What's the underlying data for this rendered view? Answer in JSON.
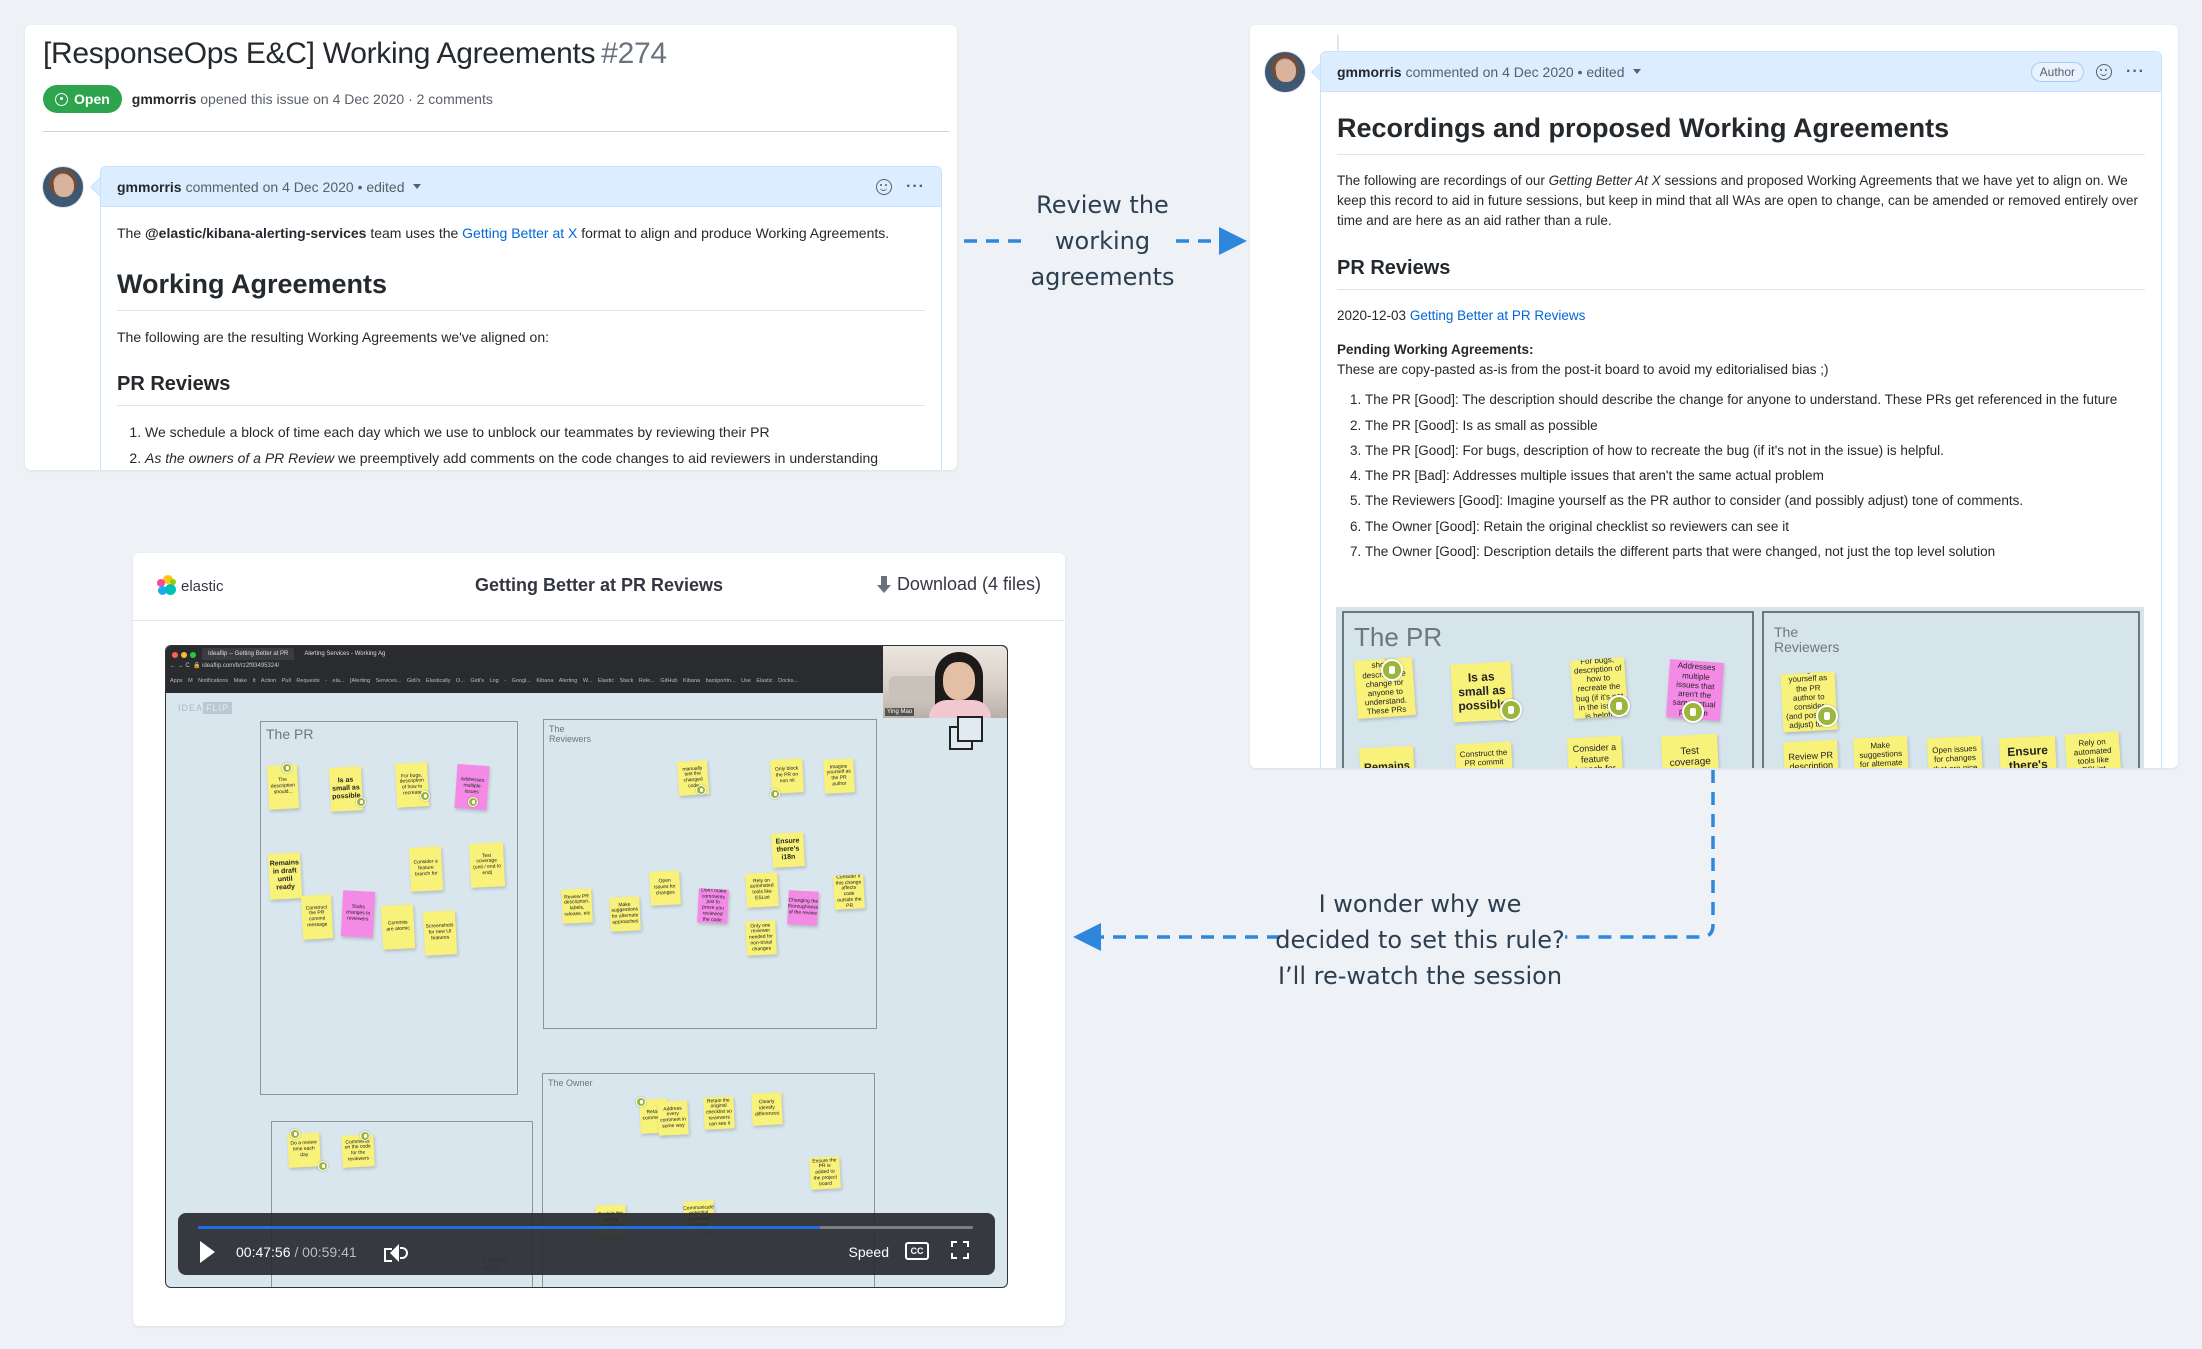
{
  "issue": {
    "title": "[ResponseOps E&C] Working Agreements",
    "number": "#274",
    "state": "Open",
    "author": "gmmorris",
    "meta": "opened this issue on 4 Dec 2020 · 2 comments",
    "comment": {
      "author": "gmmorris",
      "meta": "commented on 4 Dec 2020 • edited",
      "intro_prefix": "The",
      "team": "@elastic/kibana-alerting-services",
      "intro_mid": "team uses the",
      "link": "Getting Better at X",
      "intro_suffix": "format to align and produce Working Agreements.",
      "h1": "Working Agreements",
      "para": "The following are the resulting Working Agreements we've aligned on:",
      "h2": "PR Reviews",
      "items": [
        {
          "em": "",
          "text": "We schedule a block of time each day which we use to unblock our teammates by reviewing their PR"
        },
        {
          "em": "As the owners of a PR Review",
          "text": " we preemptively add comments on the code changes to aid reviewers in understanding"
        }
      ]
    }
  },
  "right_comment": {
    "author": "gmmorris",
    "meta": "commented on 4 Dec 2020 • edited",
    "badge": "Author",
    "h1": "Recordings and proposed Working Agreements",
    "intro_prefix": "The following are recordings of our",
    "intro_em": "Getting Better At X",
    "intro_suffix": "sessions and proposed Working Agreements that we have yet to align on. We keep this record to aid in future sessions, but keep in mind that all WAs are open to change, can be amended or removed entirely over time and are here as an aid rather than a rule.",
    "h2": "PR Reviews",
    "date": "2020-12-03",
    "session_link": "Getting Better at PR Reviews",
    "pending_label": "Pending Working Agreements:",
    "pending_note": "These are copy-pasted as-is from the post-it board to avoid my editorialised bias ;)",
    "items": [
      "The PR [Good]: The description should describe the change for anyone to understand. These PRs get referenced in the future",
      "The PR [Good]: Is as small as possible",
      "The PR [Good]: For bugs, description of how to recreate the bug (if it's not in the issue) is helpful.",
      "The PR [Bad]: Addresses multiple issues that aren't the same actual problem",
      "The Reviewers [Good]: Imagine yourself as the PR author to consider (and possibly adjust) tone of comments.",
      "The Owner [Good]: Retain the original checklist so reviewers can see it",
      "The Owner [Good]: Description details the different parts that were changed, not just the top level solution"
    ],
    "board": {
      "groups": [
        "The PR",
        "The\nReviewers"
      ],
      "stickies": [
        "The description should describe the change for anyone to understand. These PRs get referenced in the future",
        "Is as small as possible",
        "For bugs, description of how to recreate the bug (if it's not in the issue) is helpful",
        "Addresses multiple issues that aren't the same actual problem",
        "Remains",
        "Construct the PR commit message",
        "Consider a feature branch for",
        "Test coverage",
        "Imagine yourself as the PR author to consider (and possibly adjust) tone of comments",
        "Review PR description",
        "Make suggestions for alternate approaches",
        "Open issues for changes that are nice",
        "Ensure there's",
        "Rely on automated tools like ESLint"
      ]
    }
  },
  "video": {
    "brand": "elastic",
    "title": "Getting Better at PR Reviews",
    "download_label": "Download (4 files)",
    "browser": {
      "tabs": [
        "Ideaflip -- Getting Better at PR",
        "Alerting Services - Working Ag"
      ],
      "url": "ideaflip.com/b/rz2f93495324/",
      "bookmarks": "Apps  M  Notifications  Make It Action  Pull Requests - ela...  [Alerting Services...  Gidi's Elastically O...  Gidi's Log - Googl...  Kibana Alerting W...  Elastic Stack Rele...  GitHub  Kibana backportin...  Use Elastic Docks..."
    },
    "board_logo_a": "IDEA",
    "board_logo_b": "FLIP",
    "webcam_name": "Ying Mao",
    "groups": [
      "The PR",
      "The\nReviewers",
      "The Owner",
      ""
    ],
    "group_placeholder": "GROUP\nTITLE",
    "stickies": {
      "pr": [
        "The description should...",
        "Is as small as possible",
        "For bugs, description of how to recreate",
        "Addresses multiple issues",
        "Remains in draft until ready",
        "Consider a feature branch for",
        "Test coverage (unit / end to end)",
        "Construct the PR commit message",
        "Stubs changes to reviewers",
        "Commits are atomic",
        "Screenshots for new UI features"
      ],
      "reviewers": [
        "manually test the changed code",
        "Only block the PR on non nit",
        "Imagine yourself as the PR author",
        "Ensure there's i18n",
        "Review PR description, labels, release, etc",
        "Make suggestions for alternate approaches",
        "Open issues for changes",
        "Don't make comments just to prove you reviewed the code",
        "Rely on automated tools like ESLint",
        "Changing the thoroughness of the review",
        "Only one reviewer needed for non-trivial changes",
        "Consider if this change affects code outside the PR"
      ],
      "owner": [
        "Retain comments",
        "Address every comment in some way",
        "Retain the original checklist so reviewers can see it",
        "Clearly identify differences",
        "Ensure the PR is added to the project board",
        "Communicate potential conflicting changes",
        "Explain the testing approach"
      ],
      "other": [
        "Do a review time each day",
        "Comments on the code for the reviewers"
      ]
    },
    "progress": 0.803,
    "current_time": "00:47:56",
    "duration": "00:59:41",
    "speed_label": "Speed",
    "cc_label": "CC"
  },
  "annotations": {
    "top": "Review the working agreements",
    "bottom_lines": [
      "I wonder why we",
      "decided to set this rule?",
      "I’ll re-watch the session"
    ]
  },
  "colors": {
    "background": "#eef2f6",
    "arrow": "#2f86dd",
    "link": "#0366d6",
    "open_badge": "#2ea44f",
    "comment_header": "#dbedff",
    "sticky_yellow": "#f9f27a",
    "sticky_pink": "#f58ae6",
    "progress": "#1f6fe0"
  }
}
